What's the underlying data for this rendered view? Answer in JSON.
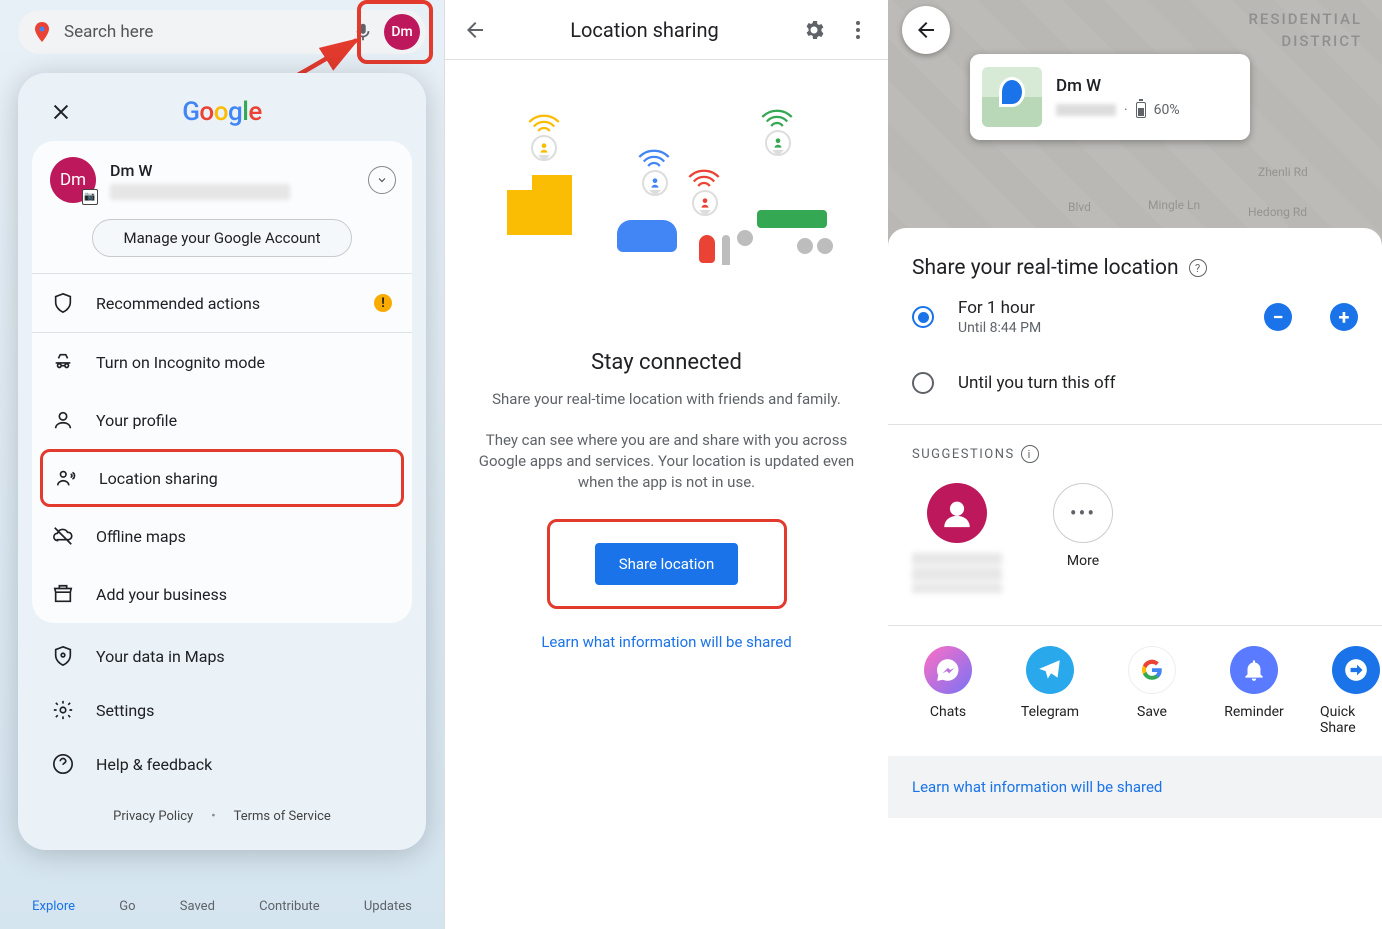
{
  "panel1": {
    "search_placeholder": "Search here",
    "avatar_initials": "Dm",
    "google_logo": [
      "G",
      "o",
      "o",
      "g",
      "l",
      "e"
    ],
    "account": {
      "name": "Dm W",
      "avatar_initials": "Dm"
    },
    "manage_btn": "Manage your Google Account",
    "menu": {
      "recommended": "Recommended actions",
      "recommended_badge": "!",
      "incognito": "Turn on Incognito mode",
      "profile": "Your profile",
      "location_sharing": "Location sharing",
      "offline": "Offline maps",
      "business": "Add your business",
      "your_data": "Your data in Maps",
      "settings": "Settings",
      "help": "Help & feedback"
    },
    "footer": {
      "privacy": "Privacy Policy",
      "terms": "Terms of Service"
    },
    "bottom_nav": [
      "Explore",
      "Go",
      "Saved",
      "Contribute",
      "Updates"
    ]
  },
  "panel2": {
    "title": "Location sharing",
    "heading": "Stay connected",
    "sub1": "Share your real-time location with friends and family.",
    "sub2": "They can see where you are and share with you across Google apps and services. Your location is updated even when the app is not in use.",
    "share_btn": "Share location",
    "learn": "Learn what information will be shared"
  },
  "panel3": {
    "map_labels": {
      "residential": "RESIDENTIAL",
      "district": "DISTRICT"
    },
    "roads": [
      "Blvd",
      "Mingle Ln",
      "Zhenli Rd",
      "Hedong Rd"
    ],
    "contact": {
      "name": "Dm W",
      "battery": "60%"
    },
    "sheet": {
      "title": "Share your real-time location",
      "opt1_main": "For 1 hour",
      "opt1_sub": "Until 8:44 PM",
      "opt2": "Until you turn this off",
      "suggestions_hdr": "SUGGESTIONS",
      "more": "More",
      "share_apps": [
        "Chats",
        "Telegram",
        "Save",
        "Reminder",
        "Quick Share"
      ],
      "learn": "Learn what information will be shared"
    }
  }
}
